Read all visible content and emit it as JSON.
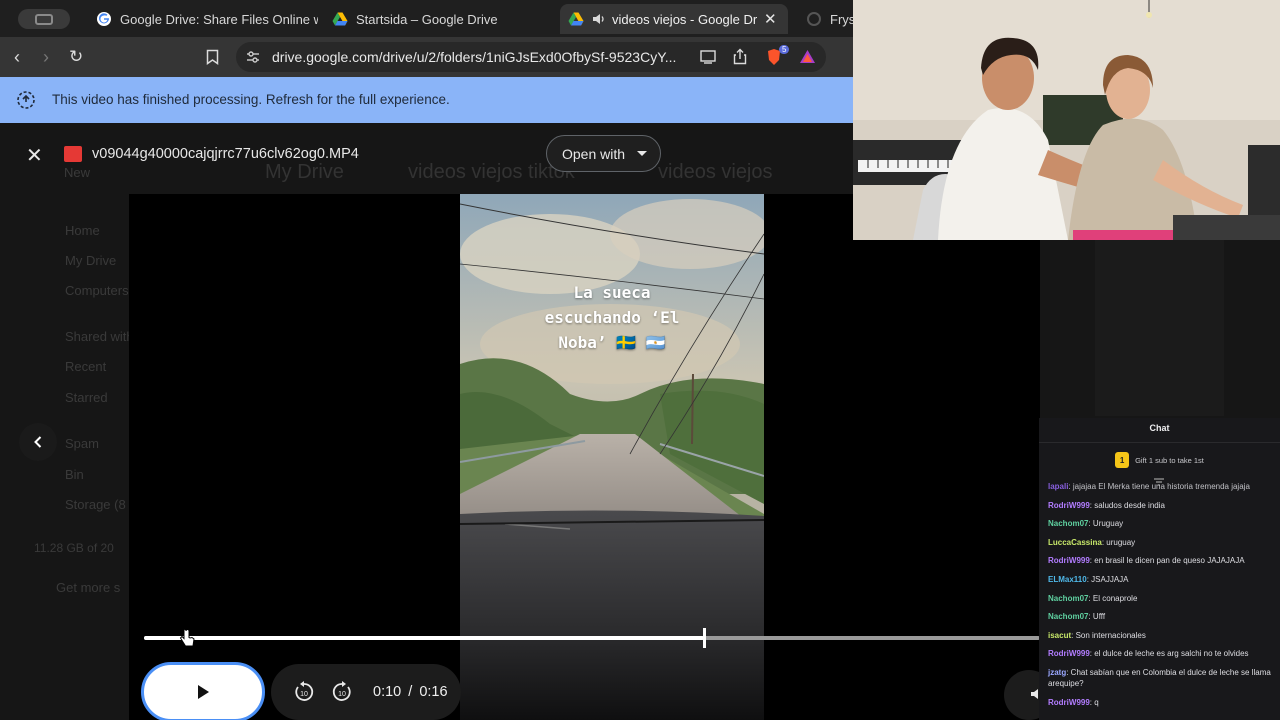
{
  "browser": {
    "tabs": [
      {
        "title": "Google Drive: Share Files Online w",
        "active": false
      },
      {
        "title": "Startsida – Google Drive",
        "active": false
      },
      {
        "title": "videos viejos - Google Drive",
        "active": true
      },
      {
        "title": "Frysr",
        "active": false
      }
    ],
    "url": "drive.google.com/drive/u/2/folders/1niGJsExd0OfbySf-9523CyY...",
    "extension_badge": "5"
  },
  "banner": {
    "text": "This video has finished processing. Refresh for the full experience."
  },
  "drive_background": {
    "new_label": "New",
    "breadcrumb": [
      "My Drive",
      "videos viejos tiktok",
      "videos viejos"
    ],
    "sidebar": [
      "Home",
      "My Drive",
      "Computers",
      "Shared with",
      "Recent",
      "Starred",
      "Spam",
      "Bin",
      "Storage (8"
    ],
    "storage_text": "11.28 GB of 20",
    "get_more": "Get more s"
  },
  "viewer": {
    "file_name": "v09044g40000cajqjrrc77u6clv62og0.MP4",
    "open_with_label": "Open with"
  },
  "video": {
    "overlay_lines": [
      "La sueca",
      "escuchando ‘El",
      "Noba’ 🇸🇪 🇦🇷"
    ],
    "current_time": "0:10",
    "duration": "0:16",
    "time_separator": "/",
    "progress_fraction": 0.625
  },
  "chat": {
    "title": "Chat",
    "gift_badge": "1",
    "gift_text": "Gift 1 sub to take 1st",
    "messages": [
      {
        "user": "lapali",
        "text": "jajajaa El Merka tiene una historia tremenda jajaja",
        "color": "#9b6bff"
      },
      {
        "user": "RodriW999",
        "text": "saludos desde india",
        "color": "#b27dff"
      },
      {
        "user": "Nachom07",
        "text": "Uruguay",
        "color": "#5fd0a0"
      },
      {
        "user": "LuccaCassina",
        "text": "uruguay",
        "color": "#c8e86a"
      },
      {
        "user": "RodriW999",
        "text": "en brasil le dicen pan de queso JAJAJAJA",
        "color": "#b27dff"
      },
      {
        "user": "ELMax110",
        "text": "JSAJJAJA",
        "color": "#4fb8e8"
      },
      {
        "user": "Nachom07",
        "text": "El conaprole",
        "color": "#5fd0a0"
      },
      {
        "user": "Nachom07",
        "text": "Ufff",
        "color": "#5fd0a0"
      },
      {
        "user": "isacut",
        "text": "Son internacionales",
        "color": "#c8e86a"
      },
      {
        "user": "RodriW999",
        "text": "el dulce de leche es arg salchi no te olvides",
        "color": "#b27dff"
      },
      {
        "user": "jzatg",
        "text": "Chat sabían que en Colombia el dulce de leche se llama arequipe?",
        "color": "#9aa7ff"
      },
      {
        "user": "RodriW999",
        "text": "q",
        "color": "#b27dff"
      }
    ]
  }
}
